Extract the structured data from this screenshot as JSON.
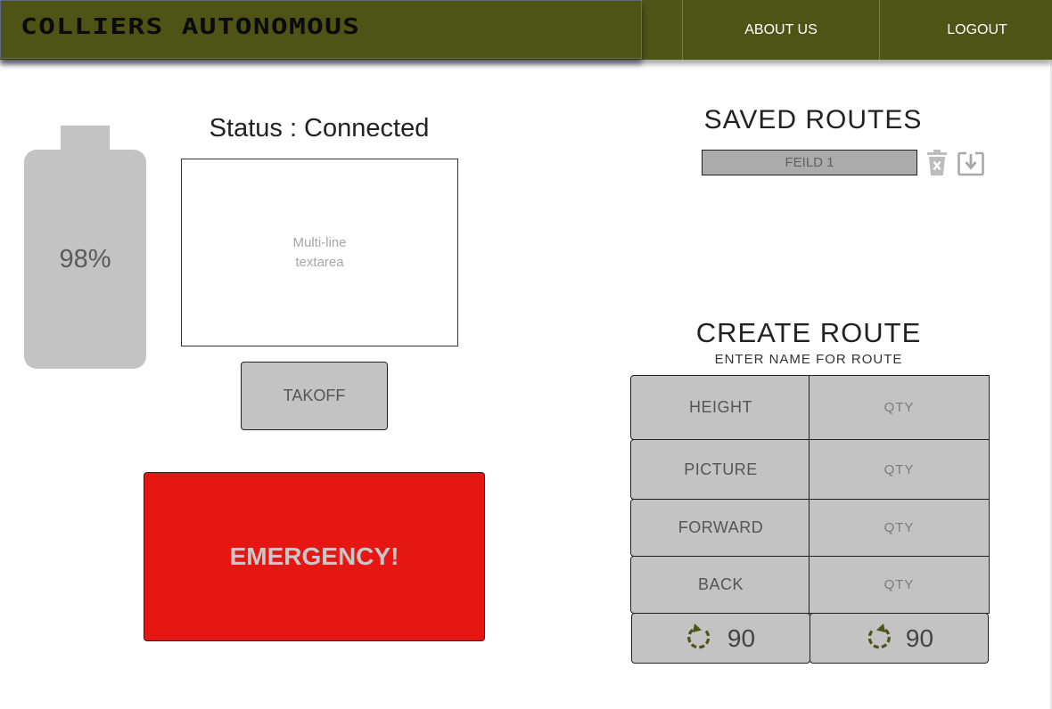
{
  "header": {
    "brand": "COLLIERS AUTONOMOUS",
    "nav": {
      "about_label": "ABOUT US",
      "logout_label": "LOGOUT"
    },
    "color": "#4e5316"
  },
  "battery": {
    "level_text": "98%",
    "level": 0.98
  },
  "status": {
    "text": "Status : Connected"
  },
  "textarea": {
    "placeholder": "Multi-line\ntextarea"
  },
  "controls": {
    "takeoff_label": "TAKOFF",
    "emergency_label": "EMERGENCY!",
    "emergency_color": "#e61713"
  },
  "saved_routes": {
    "title": "SAVED ROUTES",
    "items": [
      {
        "name": "FEILD 1"
      }
    ],
    "icons": [
      "trash-icon",
      "download-icon"
    ]
  },
  "create_route": {
    "title": "CREATE ROUTE",
    "name_placeholder": "ENTER NAME FOR ROUTE",
    "commands": [
      {
        "label": "HEIGHT",
        "qty_placeholder": "QTY"
      },
      {
        "label": "PICTURE",
        "qty_placeholder": "QTY"
      },
      {
        "label": "FORWARD",
        "qty_placeholder": "QTY"
      },
      {
        "label": "BACK",
        "qty_placeholder": "QTY"
      }
    ],
    "rotate": [
      {
        "icon": "rotate-clockwise-icon",
        "value": "90"
      },
      {
        "icon": "rotate-counterclockwise-icon",
        "value": "90"
      }
    ],
    "icon_color": "#4e5316"
  }
}
